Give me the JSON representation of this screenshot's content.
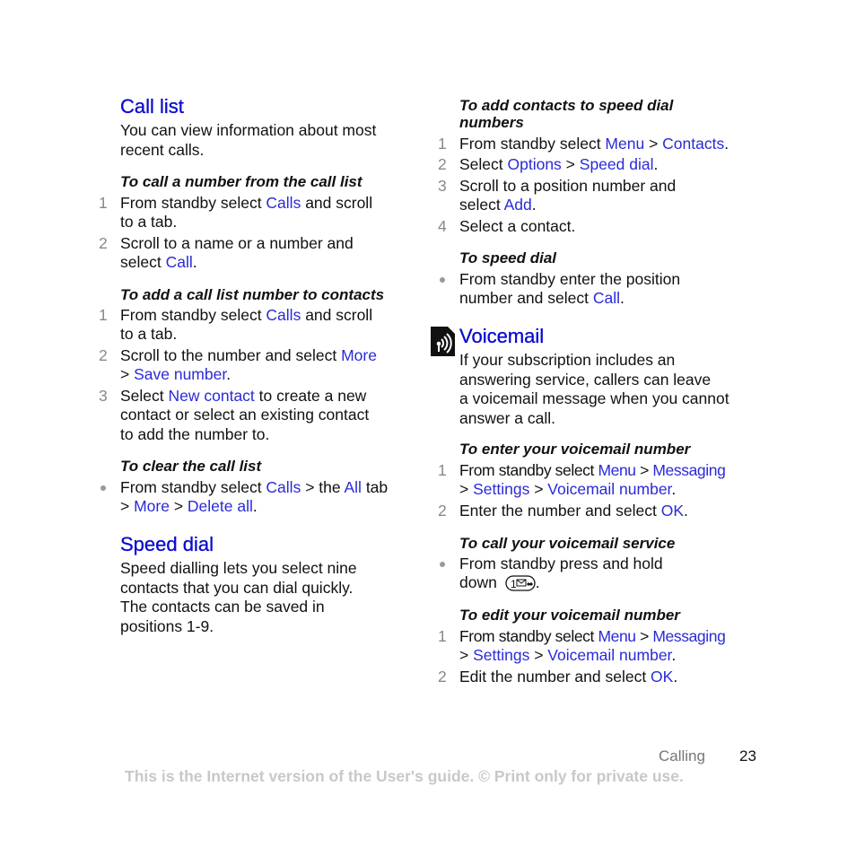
{
  "left": {
    "call_list": {
      "title": "Call list",
      "intro": [
        "You can view information about most",
        "recent calls."
      ],
      "sub1": "To call a number from the call list",
      "sub1_steps": [
        {
          "n": "1",
          "l1": [
            "From standby select ",
            "Calls",
            " and scroll"
          ],
          "l2": "to a tab."
        },
        {
          "n": "2",
          "l1": "Scroll to a name or a number and",
          "l2": [
            "select ",
            "Call",
            "."
          ]
        }
      ],
      "sub2": "To add a call list number to contacts",
      "sub2_steps": [
        {
          "n": "1",
          "l1": [
            "From standby select ",
            "Calls",
            " and scroll"
          ],
          "l2": "to a tab."
        },
        {
          "n": "2",
          "l1": [
            "Scroll to the number and select ",
            "More"
          ],
          "l2": [
            "> ",
            "Save number",
            "."
          ]
        },
        {
          "n": "3",
          "l1": [
            "Select ",
            "New contact",
            " to create a new"
          ],
          "l2": "contact or select an existing contact",
          "l3": "to add the number to."
        }
      ],
      "sub3": "To clear the call list",
      "sub3_bullet": {
        "l1": [
          "From standby select ",
          "Calls",
          " > the ",
          "All",
          " tab"
        ],
        "l2": [
          "> ",
          "More",
          " > ",
          "Delete all",
          "."
        ]
      }
    },
    "speed_dial": {
      "title": "Speed dial",
      "intro": [
        "Speed dialling lets you select nine",
        "contacts that you can dial quickly.",
        "The contacts can be saved in",
        "positions 1-9."
      ]
    }
  },
  "right": {
    "sub1": [
      "To add contacts to speed dial",
      "numbers"
    ],
    "sub1_steps": [
      {
        "n": "1",
        "l1": [
          "From standby select ",
          "Menu",
          " > ",
          "Contacts",
          "."
        ]
      },
      {
        "n": "2",
        "l1": [
          "Select ",
          "Options",
          " > ",
          "Speed dial",
          "."
        ]
      },
      {
        "n": "3",
        "l1": "Scroll to a position number and",
        "l2": [
          "select ",
          "Add",
          "."
        ]
      },
      {
        "n": "4",
        "l1": "Select a contact."
      }
    ],
    "sub2": "To speed dial",
    "sub2_bullet": {
      "l1": "From standby enter the position",
      "l2": [
        "number and select ",
        "Call",
        "."
      ]
    },
    "voicemail": {
      "icon": "voicemail-network-service-icon",
      "title": "Voicemail",
      "intro": [
        "If your subscription includes an",
        "answering service, callers can leave",
        "a voicemail message when you cannot",
        "answer a call."
      ],
      "sub1": "To enter your voicemail number",
      "sub1_steps": [
        {
          "n": "1",
          "l1": [
            "From standby select ",
            "Menu",
            " > ",
            "Messaging"
          ],
          "l2": [
            "> ",
            "Settings",
            " > ",
            "Voicemail number",
            "."
          ]
        },
        {
          "n": "2",
          "l1": [
            "Enter the number and select ",
            "OK",
            "."
          ]
        }
      ],
      "sub2": "To call your voicemail service",
      "sub2_bullet": {
        "l1": "From standby press and hold",
        "l2": "down",
        "key": "1-voicemail-key-icon",
        "l2_end": "."
      },
      "sub3": "To edit your voicemail number",
      "sub3_steps": [
        {
          "n": "1",
          "l1": [
            "From standby select ",
            "Menu",
            " > ",
            "Messaging"
          ],
          "l2": [
            "> ",
            "Settings",
            " > ",
            "Voicemail number",
            "."
          ]
        },
        {
          "n": "2",
          "l1": [
            "Edit the number and select ",
            "OK",
            "."
          ]
        }
      ]
    }
  },
  "footer": {
    "section": "Calling",
    "page": "23",
    "disclaimer": "This is the Internet version of the User's guide. © Print only for private use."
  },
  "colors": {
    "heading": "#0a0ad0",
    "link": "#2a2ad8",
    "step_number": "#888888",
    "disclaimer": "#c8c8c8"
  }
}
